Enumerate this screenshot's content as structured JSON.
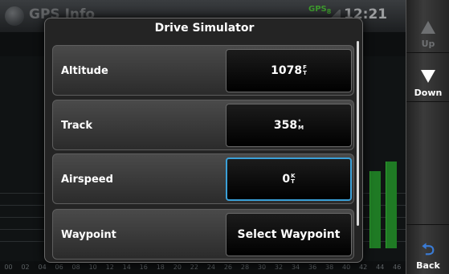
{
  "background": {
    "title": "GPS Info",
    "gps_label": "GPS",
    "gps_sub": "8",
    "time": "12:21",
    "axis_ticks": [
      "00",
      "02",
      "04",
      "06",
      "08",
      "10",
      "12",
      "14",
      "16",
      "18",
      "20",
      "22",
      "24",
      "26",
      "28",
      "30",
      "32",
      "34",
      "36",
      "38",
      "40",
      "42",
      "44",
      "46"
    ],
    "satellite_signal_levels": [
      0.4,
      0.45
    ]
  },
  "softkeys": {
    "up_label": "Up",
    "down_label": "Down",
    "back_label": "Back",
    "back_icon": "back-arrow-icon"
  },
  "dialog": {
    "title": "Drive Simulator",
    "rows": [
      {
        "label": "Altitude",
        "value": "1078",
        "unit_top": "F",
        "unit_bottom": "T"
      },
      {
        "label": "Track",
        "value": "358",
        "unit_top": "°",
        "unit_bottom": "M"
      },
      {
        "label": "Airspeed",
        "value": "0",
        "unit_top": "K",
        "unit_bottom": "T"
      },
      {
        "label": "Waypoint",
        "value": "Select Waypoint"
      }
    ]
  },
  "colors": {
    "active_border": "#3aa0d8",
    "satellite_bar": "#1f7a24",
    "back_icon": "#3a7bd5"
  }
}
